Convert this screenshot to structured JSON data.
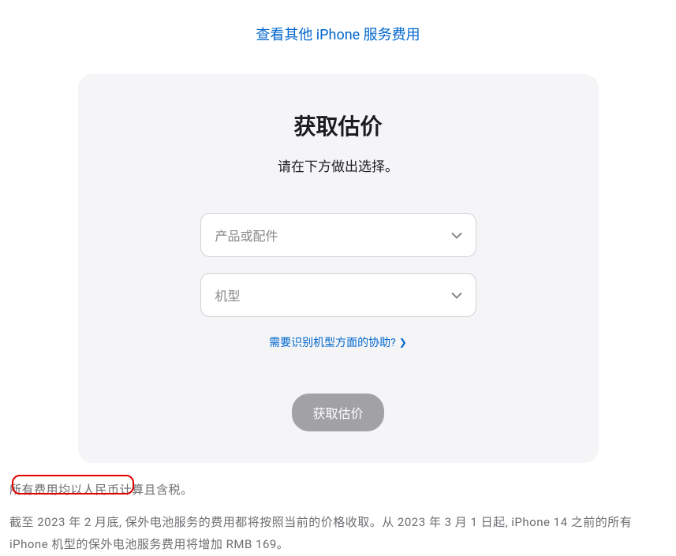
{
  "top_link": {
    "label": "查看其他 iPhone 服务费用"
  },
  "card": {
    "title": "获取估价",
    "subtitle": "请在下方做出选择。",
    "product_select_placeholder": "产品或配件",
    "model_select_placeholder": "机型",
    "help_link_label": "需要识别机型方面的协助?",
    "submit_label": "获取估价"
  },
  "footer": {
    "line1": "所有费用均以人民币计算且含税。",
    "line2": "截至 2023 年 2 月底, 保外电池服务的费用都将按照当前的价格收取。从 2023 年 3 月 1 日起, iPhone 14 之前的所有 iPhone 机型的保外电池服务费用将增加 RMB 169。"
  }
}
